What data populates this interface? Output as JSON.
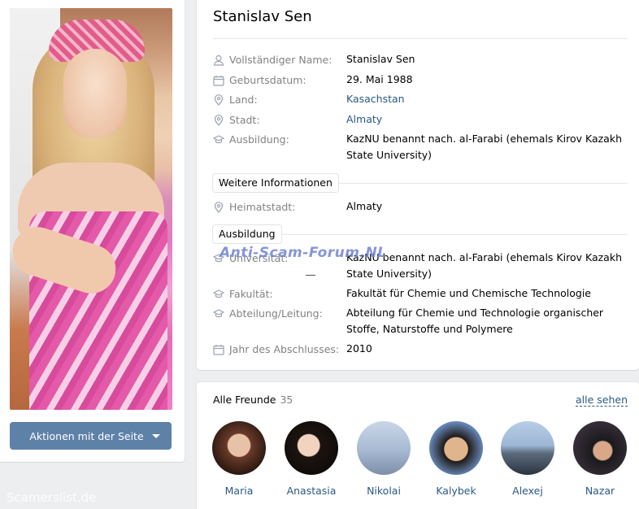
{
  "profile": {
    "name": "Stanislav Sen",
    "actions_button": "Aktionen mit der Seite"
  },
  "info": [
    {
      "icon": "user-icon",
      "label": "Vollständiger Name:",
      "value": "Stanislav Sen",
      "link": false
    },
    {
      "icon": "calendar-icon",
      "label": "Geburtsdatum:",
      "value": "29. Mai 1988",
      "link": false
    },
    {
      "icon": "location-icon",
      "label": "Land:",
      "value": "Kasachstan",
      "link": true
    },
    {
      "icon": "location-icon",
      "label": "Stadt:",
      "value": "Almaty",
      "link": true
    },
    {
      "icon": "graduation-cap-icon",
      "label": "Ausbildung:",
      "value": "KazNU benannt nach. al-Farabi (ehemals Kirov Kazakh State University)",
      "link": false
    }
  ],
  "more_info": {
    "section_label": "Weitere Informationen",
    "rows": [
      {
        "icon": "location-icon",
        "label": "Heimatstadt:",
        "value": "Almaty"
      }
    ]
  },
  "education": {
    "section_label": "Ausbildung",
    "rows": [
      {
        "icon": "graduation-cap-icon",
        "label": "Universität:",
        "value": "KazNU benannt nach. al-Farabi (ehemals Kirov Kazakh State University)"
      },
      {
        "icon": "graduation-cap-icon",
        "label": "Fakultät:",
        "value": "Fakultät für Chemie und Chemische Technologie"
      },
      {
        "icon": "graduation-cap-icon",
        "label": "Abteilung/Leitung:",
        "value": "Abteilung für Chemie und Technologie organischer Stoffe, Naturstoffe und Polymere"
      },
      {
        "icon": "calendar-icon",
        "label": "Jahr des Abschlusses:",
        "value": "2010"
      }
    ]
  },
  "friends": {
    "title": "Alle Freunde",
    "count": "35",
    "see_all": "alle sehen",
    "items": [
      {
        "name": "Maria"
      },
      {
        "name": "Anastasia"
      },
      {
        "name": "Nikolai"
      },
      {
        "name": "Kalybek"
      },
      {
        "name": "Alexej"
      },
      {
        "name": "Nazar"
      }
    ]
  },
  "watermarks": {
    "center": "Anti-Scam-Forum.NL",
    "corner": "Scamerslist.de"
  },
  "colors": {
    "link": "#2a5885",
    "button": "#5e81a8",
    "label": "#828282",
    "watermark": "#6e82d2"
  }
}
